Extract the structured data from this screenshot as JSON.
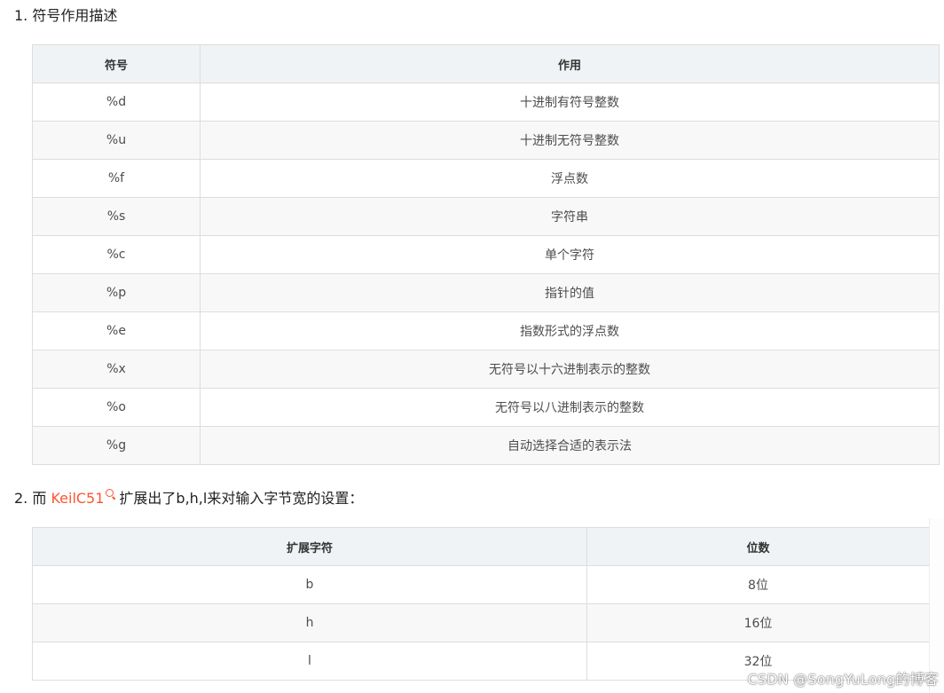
{
  "section1": {
    "heading": "1. 符号作用描述",
    "table": {
      "headers": [
        "符号",
        "作用"
      ],
      "rows": [
        [
          "%d",
          "十进制有符号整数"
        ],
        [
          "%u",
          "十进制无符号整数"
        ],
        [
          "%f",
          "浮点数"
        ],
        [
          "%s",
          "字符串"
        ],
        [
          "%c",
          "单个字符"
        ],
        [
          "%p",
          "指针的值"
        ],
        [
          "%e",
          "指数形式的浮点数"
        ],
        [
          "%x",
          "无符号以十六进制表示的整数"
        ],
        [
          "%o",
          "无符号以八进制表示的整数"
        ],
        [
          "%g",
          "自动选择合适的表示法"
        ]
      ]
    }
  },
  "section2": {
    "heading_prefix": "2. 而 ",
    "link_text": "KeilC51",
    "link_icon": "search-icon",
    "heading_suffix": "扩展出了b,h,l来对输入字节宽的设置：",
    "table": {
      "headers": [
        "扩展字符",
        "位数"
      ],
      "rows": [
        [
          "b",
          "8位"
        ],
        [
          "h",
          "16位"
        ],
        [
          "l",
          "32位"
        ]
      ]
    }
  },
  "watermark": "CSDN @SongYuLong的博客",
  "colors": {
    "link": "#fc5531",
    "header_bg": "#eff3f5",
    "border": "#dddddd"
  }
}
